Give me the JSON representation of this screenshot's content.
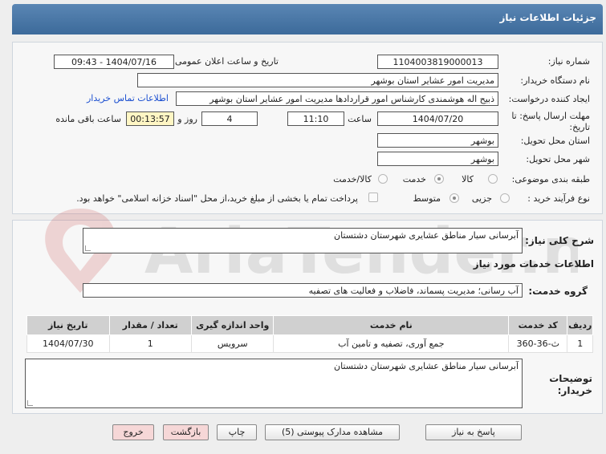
{
  "header": {
    "title": "جزئیات اطلاعات نیاز"
  },
  "form": {
    "need_number_label": "شماره نیاز:",
    "need_number": "1104003819000013",
    "announce_label": "تاریخ و ساعت اعلان عمومی:",
    "announce_value": "1404/07/16 - 09:43",
    "buyer_org_label": "نام دستگاه خریدار:",
    "buyer_org": "مدیریت امور عشایر استان بوشهر",
    "creator_label": "ایجاد کننده درخواست:",
    "creator": "ذبیح اله هوشمندی کارشناس امور قراردادها  مدیریت امور عشایر استان بوشهر",
    "contact_link": "اطلاعات تماس خریدار",
    "deadline_label_1": "مهلت ارسال پاسخ: تا",
    "deadline_label_2": "تاریخ:",
    "deadline_date": "1404/07/20",
    "time_label": "ساعت",
    "deadline_time": "11:10",
    "days_value": "4",
    "days_label": "روز و",
    "remaining_time": "00:13:57",
    "remaining_label": "ساعت باقی مانده",
    "province_label": "استان محل تحویل:",
    "province": "بوشهر",
    "city_label": "شهر محل تحویل:",
    "city": "بوشهر",
    "category_label": "طبقه بندی موضوعی:",
    "category_options": [
      "کالا",
      "خدمت",
      "کالا/خدمت"
    ],
    "process_label": "نوع فرآیند خرید :",
    "process_options": [
      "جزیی",
      "متوسط"
    ],
    "payment_note": "پرداخت تمام یا بخشی از مبلغ خرید،از محل \"اسناد خزانه اسلامی\" خواهد بود."
  },
  "details": {
    "summary_label": "شرح کلی نیاز:",
    "summary": "آبرسانی سیار مناطق عشایری شهرستان دشتستان",
    "services_title": "اطلاعات خدمات مورد نیاز",
    "service_group_label": "گروه خدمت:",
    "service_group": "آب رسانی؛ مدیریت پسماند، فاضلاب و فعالیت های تصفیه",
    "table": {
      "headers": [
        "ردیف",
        "کد خدمت",
        "نام خدمت",
        "واحد اندازه گیری",
        "تعداد / مقدار",
        "تاریخ نیاز"
      ],
      "rows": [
        [
          "1",
          "ث-36-360",
          "جمع آوری، تصفیه و تامین آب",
          "سرویس",
          "1",
          "1404/07/30"
        ]
      ]
    },
    "buyer_notes_label_1": "توضیحات",
    "buyer_notes_label_2": "خریدار:",
    "buyer_notes": "آبرسانی سیار مناطق عشایری شهرستان دشتستان"
  },
  "buttons": {
    "reply": "پاسخ به نیاز",
    "attachments": "مشاهده مدارک پیوستی (5)",
    "print": "چاپ",
    "back": "بازگشت",
    "exit": "خروج"
  },
  "watermark": {
    "text": "AriaTender.neT"
  }
}
